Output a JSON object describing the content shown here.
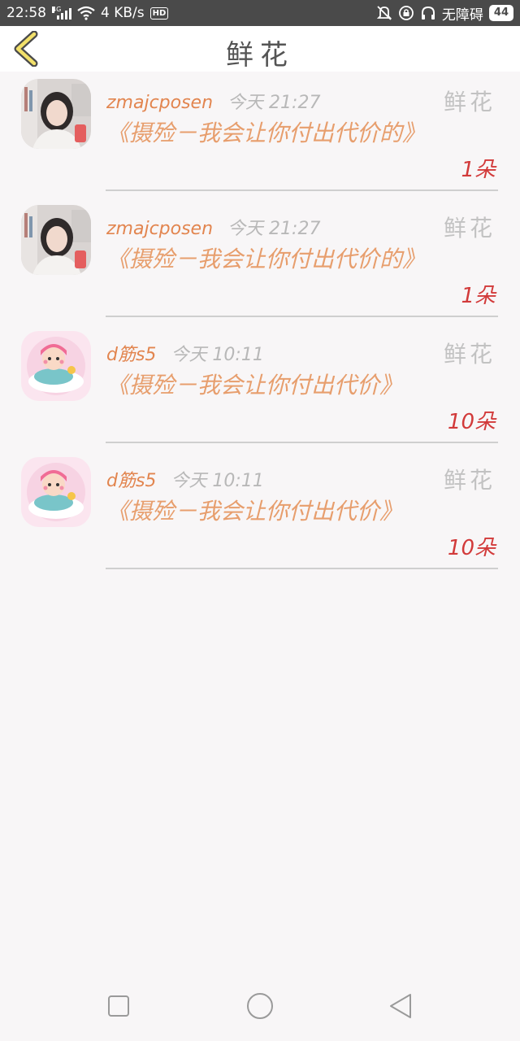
{
  "status_bar": {
    "time": "22:58",
    "network_type": "4G",
    "speed": "4 KB/s",
    "hd": "HD",
    "accessibility": "无障碍",
    "battery": "44"
  },
  "header": {
    "title": "鲜花"
  },
  "items": [
    {
      "user": "zmajcposen",
      "time": "今天 21:27",
      "type": "鲜花",
      "gift": "《摄殓－我会让你付出代价的》",
      "count": "1朵",
      "avatar": "photo-girl"
    },
    {
      "user": "zmajcposen",
      "time": "今天 21:27",
      "type": "鲜花",
      "gift": "《摄殓－我会让你付出代价的》",
      "count": "1朵",
      "avatar": "photo-girl"
    },
    {
      "user": "d筋s5",
      "time": "今天 10:11",
      "type": "鲜花",
      "gift": "《摄殓－我会让你付出代价》",
      "count": "10朵",
      "avatar": "cartoon-girl-fish"
    },
    {
      "user": "d筋s5",
      "time": "今天 10:11",
      "type": "鲜花",
      "gift": "《摄殓－我会让你付出代价》",
      "count": "10朵",
      "avatar": "cartoon-girl-fish"
    }
  ],
  "nav": {
    "square": "recent-apps-icon",
    "circle": "home-icon",
    "triangle": "back-icon"
  }
}
